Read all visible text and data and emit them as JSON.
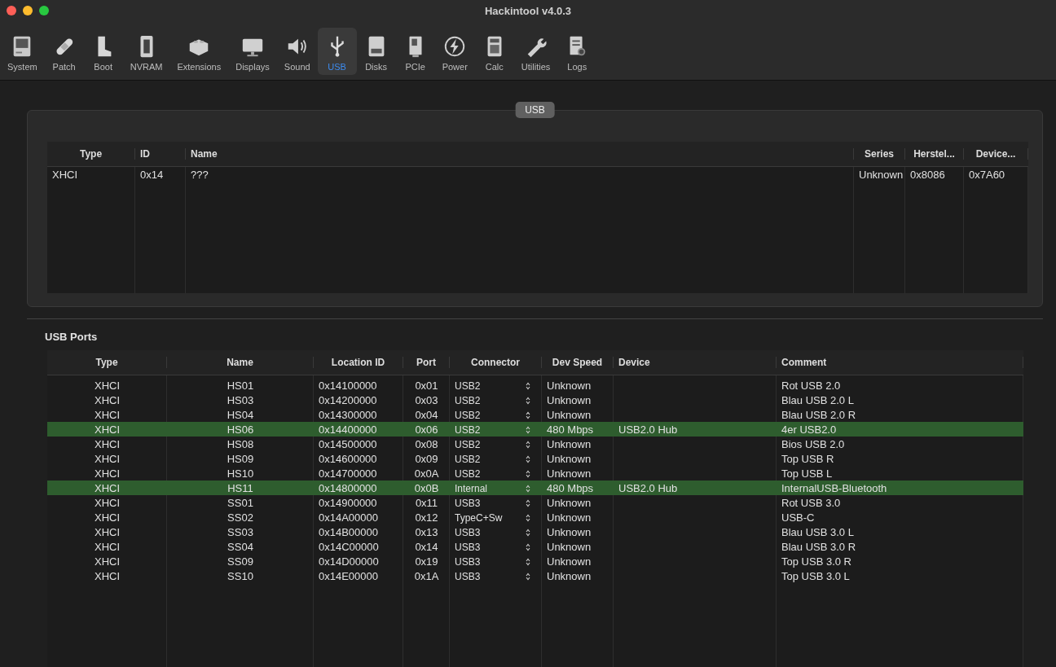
{
  "window": {
    "title": "Hackintool v4.0.3"
  },
  "toolbar": [
    {
      "label": "System",
      "selected": false
    },
    {
      "label": "Patch",
      "selected": false
    },
    {
      "label": "Boot",
      "selected": false
    },
    {
      "label": "NVRAM",
      "selected": false
    },
    {
      "label": "Extensions",
      "selected": false
    },
    {
      "label": "Displays",
      "selected": false
    },
    {
      "label": "Sound",
      "selected": false
    },
    {
      "label": "USB",
      "selected": true
    },
    {
      "label": "Disks",
      "selected": false
    },
    {
      "label": "PCIe",
      "selected": false
    },
    {
      "label": "Power",
      "selected": false
    },
    {
      "label": "Calc",
      "selected": false
    },
    {
      "label": "Utilities",
      "selected": false
    },
    {
      "label": "Logs",
      "selected": false
    }
  ],
  "controller_group": {
    "title": "USB",
    "columns": [
      "Type",
      "ID",
      "Name",
      "Series",
      "Herstel...",
      "Device..."
    ],
    "rows": [
      [
        "XHCI",
        "0x14",
        "???",
        "Unknown",
        "0x8086",
        "0x7A60"
      ]
    ]
  },
  "ports": {
    "title": "USB Ports",
    "columns": [
      "Type",
      "Name",
      "Location ID",
      "Port",
      "Connector",
      "Dev Speed",
      "Device",
      "Comment"
    ],
    "rows": [
      {
        "type": "XHCI",
        "name": "HS01",
        "location": "0x14100000",
        "port": "0x01",
        "connector": "USB2",
        "speed": "Unknown",
        "device": "",
        "comment": "Rot USB 2.0",
        "active": false
      },
      {
        "type": "XHCI",
        "name": "HS03",
        "location": "0x14200000",
        "port": "0x03",
        "connector": "USB2",
        "speed": "Unknown",
        "device": "",
        "comment": "Blau USB 2.0 L",
        "active": false
      },
      {
        "type": "XHCI",
        "name": "HS04",
        "location": "0x14300000",
        "port": "0x04",
        "connector": "USB2",
        "speed": "Unknown",
        "device": "",
        "comment": "Blau USB 2.0 R",
        "active": false
      },
      {
        "type": "XHCI",
        "name": "HS06",
        "location": "0x14400000",
        "port": "0x06",
        "connector": "USB2",
        "speed": "480 Mbps",
        "device": "USB2.0 Hub",
        "comment": "4er USB2.0",
        "active": true
      },
      {
        "type": "XHCI",
        "name": "HS08",
        "location": "0x14500000",
        "port": "0x08",
        "connector": "USB2",
        "speed": "Unknown",
        "device": "",
        "comment": "Bios USB 2.0",
        "active": false
      },
      {
        "type": "XHCI",
        "name": "HS09",
        "location": "0x14600000",
        "port": "0x09",
        "connector": "USB2",
        "speed": "Unknown",
        "device": "",
        "comment": "Top USB R",
        "active": false
      },
      {
        "type": "XHCI",
        "name": "HS10",
        "location": "0x14700000",
        "port": "0x0A",
        "connector": "USB2",
        "speed": "Unknown",
        "device": "",
        "comment": "Top USB L",
        "active": false
      },
      {
        "type": "XHCI",
        "name": "HS11",
        "location": "0x14800000",
        "port": "0x0B",
        "connector": "Internal",
        "speed": "480 Mbps",
        "device": "USB2.0 Hub",
        "comment": "InternalUSB-Bluetooth",
        "active": true
      },
      {
        "type": "XHCI",
        "name": "SS01",
        "location": "0x14900000",
        "port": "0x11",
        "connector": "USB3",
        "speed": "Unknown",
        "device": "",
        "comment": "Rot USB 3.0",
        "active": false
      },
      {
        "type": "XHCI",
        "name": "SS02",
        "location": "0x14A00000",
        "port": "0x12",
        "connector": "TypeC+Sw",
        "speed": "Unknown",
        "device": "",
        "comment": "USB-C",
        "active": false
      },
      {
        "type": "XHCI",
        "name": "SS03",
        "location": "0x14B00000",
        "port": "0x13",
        "connector": "USB3",
        "speed": "Unknown",
        "device": "",
        "comment": "Blau USB 3.0 L",
        "active": false
      },
      {
        "type": "XHCI",
        "name": "SS04",
        "location": "0x14C00000",
        "port": "0x14",
        "connector": "USB3",
        "speed": "Unknown",
        "device": "",
        "comment": "Blau USB 3.0 R",
        "active": false
      },
      {
        "type": "XHCI",
        "name": "SS09",
        "location": "0x14D00000",
        "port": "0x19",
        "connector": "USB3",
        "speed": "Unknown",
        "device": "",
        "comment": "Top USB 3.0 R",
        "active": false
      },
      {
        "type": "XHCI",
        "name": "SS10",
        "location": "0x14E00000",
        "port": "0x1A",
        "connector": "USB3",
        "speed": "Unknown",
        "device": "",
        "comment": "Top USB 3.0 L",
        "active": false
      }
    ]
  }
}
